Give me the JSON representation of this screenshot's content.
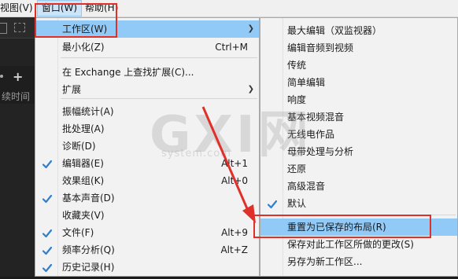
{
  "menubar": {
    "view": "视图(V)",
    "window": "窗口(W)",
    "help": "帮助(H)"
  },
  "app": {
    "duration_label": "续时间"
  },
  "window_menu": {
    "items": [
      {
        "label": "工作区(W)",
        "shortcut": "",
        "submenu": true,
        "checked": false
      },
      {
        "label": "最小化(Z)",
        "shortcut": "Ctrl+M",
        "submenu": false,
        "checked": false
      },
      {
        "label": "在 Exchange 上查找扩展(C)...",
        "shortcut": "",
        "submenu": false,
        "checked": false
      },
      {
        "label": "扩展",
        "shortcut": "",
        "submenu": true,
        "checked": false
      },
      {
        "label": "振幅统计(A)",
        "shortcut": "",
        "submenu": false,
        "checked": false
      },
      {
        "label": "批处理(A)",
        "shortcut": "",
        "submenu": false,
        "checked": false
      },
      {
        "label": "诊断(D)",
        "shortcut": "",
        "submenu": false,
        "checked": false
      },
      {
        "label": "编辑器(E)",
        "shortcut": "Alt+1",
        "submenu": false,
        "checked": true
      },
      {
        "label": "效果组(K)",
        "shortcut": "Alt+0",
        "submenu": false,
        "checked": false
      },
      {
        "label": "基本声音(D)",
        "shortcut": "",
        "submenu": false,
        "checked": true
      },
      {
        "label": "收藏夹(V)",
        "shortcut": "",
        "submenu": false,
        "checked": false
      },
      {
        "label": "文件(F)",
        "shortcut": "Alt+9",
        "submenu": false,
        "checked": true
      },
      {
        "label": "频率分析(Q)",
        "shortcut": "Alt+Z",
        "submenu": false,
        "checked": true
      },
      {
        "label": "历史记录(H)",
        "shortcut": "",
        "submenu": false,
        "checked": true
      }
    ]
  },
  "workspace_menu": {
    "items": [
      {
        "label": "最大编辑（双监视器）",
        "checked": false
      },
      {
        "label": "编辑音频到视频",
        "checked": false
      },
      {
        "label": "传统",
        "checked": false
      },
      {
        "label": "简单编辑",
        "checked": false
      },
      {
        "label": "响度",
        "checked": false
      },
      {
        "label": "基本视频混音",
        "checked": false
      },
      {
        "label": "无线电作品",
        "checked": false
      },
      {
        "label": "母带处理与分析",
        "checked": false
      },
      {
        "label": "还原",
        "checked": false
      },
      {
        "label": "高级混音",
        "checked": false
      },
      {
        "label": "默认",
        "checked": true
      },
      {
        "label": "重置为已保存的布局(R)",
        "checked": false
      },
      {
        "label": "保存对此工作区所做的更改(S)",
        "checked": false
      },
      {
        "label": "另存为新工作区...",
        "checked": false
      }
    ]
  },
  "watermark": {
    "text": "GXI网",
    "sub": "system.com"
  },
  "colors": {
    "highlight": "#91c9f7",
    "check": "#2f7fd1",
    "annotation": "#e0302a"
  }
}
